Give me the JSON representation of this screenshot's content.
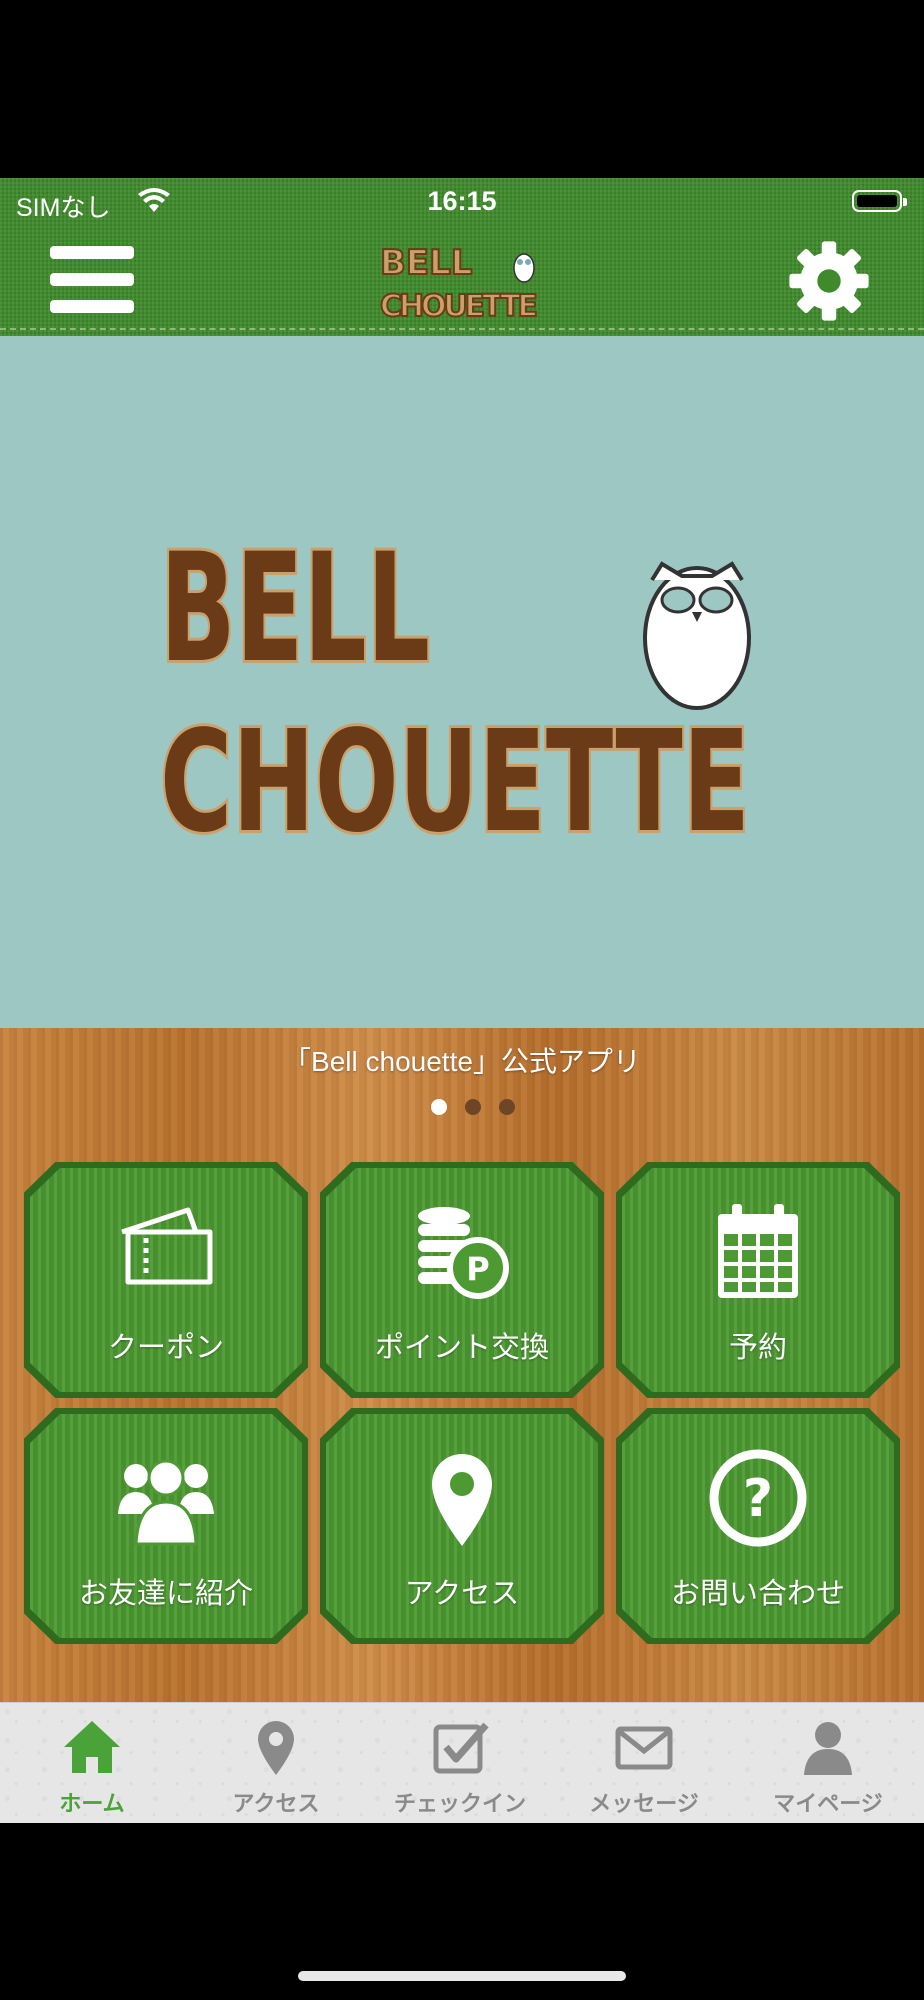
{
  "status_bar": {
    "carrier": "SIMなし",
    "time": "16:15",
    "icons": [
      "wifi-icon",
      "battery-icon"
    ]
  },
  "header": {
    "menu_icon": "hamburger-menu-icon",
    "logo_text_line1": "BELL",
    "logo_text_line2": "CHOUETTE",
    "settings_icon": "gear-icon"
  },
  "hero": {
    "logo_text_line1": "BELL",
    "logo_text_line2": "CHOUETTE",
    "slide_caption": "「Bell chouette」公式アプリ",
    "slides_count": 3,
    "active_slide": 1
  },
  "tiles": [
    {
      "label": "クーポン",
      "icon": "ticket-icon"
    },
    {
      "label": "ポイント交換",
      "icon": "coins-point-icon"
    },
    {
      "label": "予約",
      "icon": "calendar-icon"
    },
    {
      "label": "お友達に紹介",
      "icon": "group-people-icon"
    },
    {
      "label": "アクセス",
      "icon": "map-pin-icon"
    },
    {
      "label": "お問い合わせ",
      "icon": "question-circle-icon"
    }
  ],
  "bottom_nav": [
    {
      "label": "ホーム",
      "icon": "home-icon",
      "active": true
    },
    {
      "label": "アクセス",
      "icon": "map-pin-icon",
      "active": false
    },
    {
      "label": "チェックイン",
      "icon": "checkbox-icon",
      "active": false
    },
    {
      "label": "メッセージ",
      "icon": "envelope-icon",
      "active": false
    },
    {
      "label": "マイページ",
      "icon": "user-icon",
      "active": false
    }
  ],
  "colors": {
    "header_green": "#3f8b2c",
    "hero_bg": "#9dc7c3",
    "tile_green": "#4d9a33",
    "nav_active": "#4aa338",
    "nav_inactive": "#8a8a8a",
    "logo_brown": "#6b3a17",
    "logo_tan": "#caa06b"
  }
}
